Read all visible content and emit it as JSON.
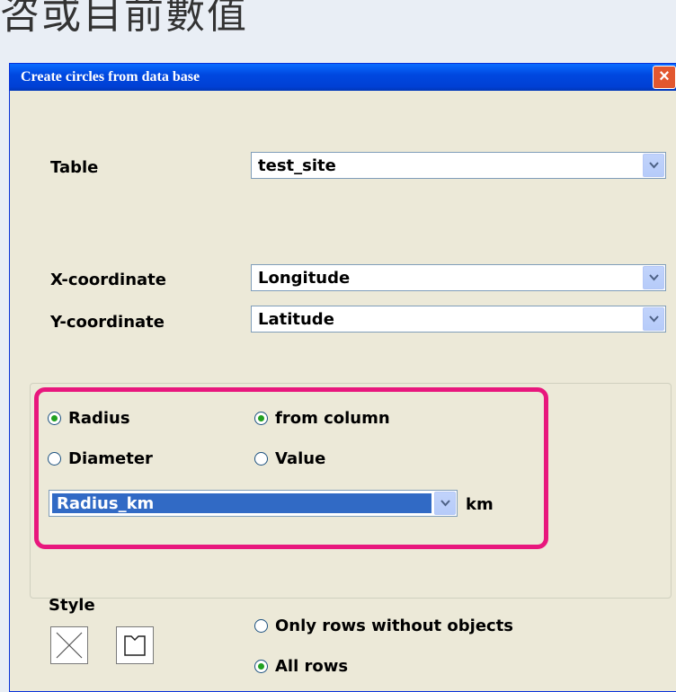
{
  "page_heading": "咨或目前數值",
  "dialog": {
    "title": "Create circles from data base",
    "close_label": "×",
    "table": {
      "label": "Table",
      "value": "test_site"
    },
    "x_coordinate": {
      "label": "X-coordinate",
      "value": "Longitude"
    },
    "y_coordinate": {
      "label": "Y-coordinate",
      "value": "Latitude"
    },
    "size_mode": {
      "radius_label": "Radius",
      "diameter_label": "Diameter",
      "selected": "Radius"
    },
    "source": {
      "from_column_label": "from column",
      "value_label": "Value",
      "selected": "from column"
    },
    "column": {
      "value": "Radius_km",
      "unit": "km"
    },
    "style_label": "Style",
    "rows": {
      "only_rows_without_objects_label": "Only rows without objects",
      "all_rows_label": "All rows",
      "selected": "All rows"
    },
    "icons": {
      "close": "close-icon",
      "dropdown": "chevron-down-icon",
      "style_cross": "cross-style-icon",
      "style_square": "square-style-icon"
    }
  }
}
